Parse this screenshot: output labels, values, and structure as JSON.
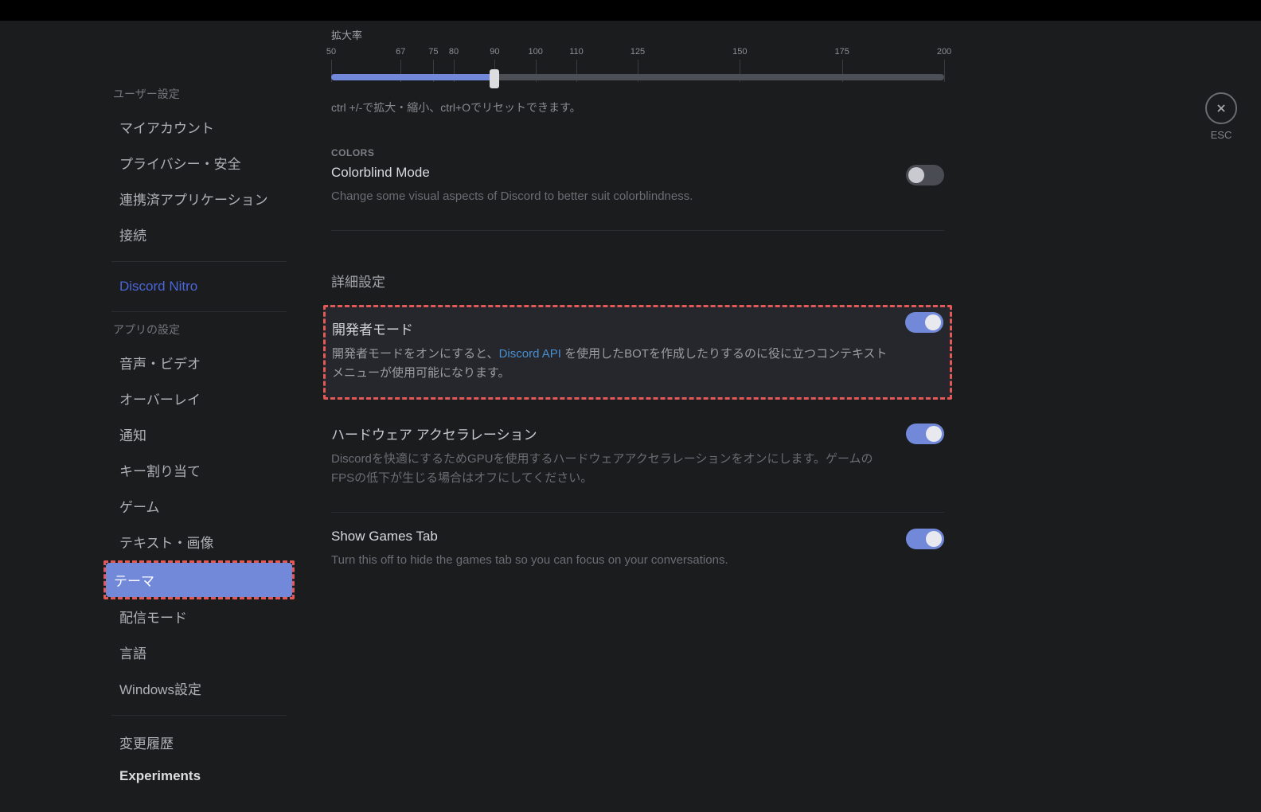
{
  "esc_label": "ESC",
  "sidebar": {
    "user_settings_header": "ユーザー設定",
    "items_user": [
      "マイアカウント",
      "プライバシー・安全",
      "連携済アプリケーション",
      "接続"
    ],
    "nitro": "Discord Nitro",
    "app_settings_header": "アプリの設定",
    "items_app": [
      "音声・ビデオ",
      "オーバーレイ",
      "通知",
      "キー割り当て",
      "ゲーム",
      "テキスト・画像",
      "テーマ",
      "配信モード",
      "言語",
      "Windows設定"
    ],
    "active": "テーマ",
    "changelog": "変更履歴",
    "experiments": "Experiments"
  },
  "zoom": {
    "label": "拡大率",
    "ticks": [
      {
        "v": "50",
        "p": 0
      },
      {
        "v": "67",
        "p": 11.33
      },
      {
        "v": "75",
        "p": 16.67
      },
      {
        "v": "80",
        "p": 20
      },
      {
        "v": "90",
        "p": 26.67
      },
      {
        "v": "100",
        "p": 33.33
      },
      {
        "v": "110",
        "p": 40
      },
      {
        "v": "125",
        "p": 50
      },
      {
        "v": "150",
        "p": 66.67
      },
      {
        "v": "175",
        "p": 83.33
      },
      {
        "v": "200",
        "p": 100
      }
    ],
    "value_pct": 26.67,
    "hint": "ctrl +/-で拡大・縮小、ctrl+Oでリセットできます。"
  },
  "colors": {
    "header": "COLORS",
    "title": "Colorblind Mode",
    "desc": "Change some visual aspects of Discord to better suit colorblindness.",
    "on": false
  },
  "advanced": {
    "header": "詳細設定",
    "dev": {
      "title": "開発者モード",
      "desc_pre": "開発者モードをオンにすると、",
      "link": "Discord API",
      "desc_post": " を使用したBOTを作成したりするのに役に立つコンテキストメニューが使用可能になります。",
      "on": true
    },
    "hw": {
      "title": "ハードウェア アクセラレーション",
      "desc": "Discordを快適にするためGPUを使用するハードウェアアクセラレーションをオンにします。ゲームのFPSの低下が生じる場合はオフにしてください。",
      "on": true
    },
    "games": {
      "title": "Show Games Tab",
      "desc": "Turn this off to hide the games tab so you can focus on your conversations.",
      "on": true
    }
  }
}
